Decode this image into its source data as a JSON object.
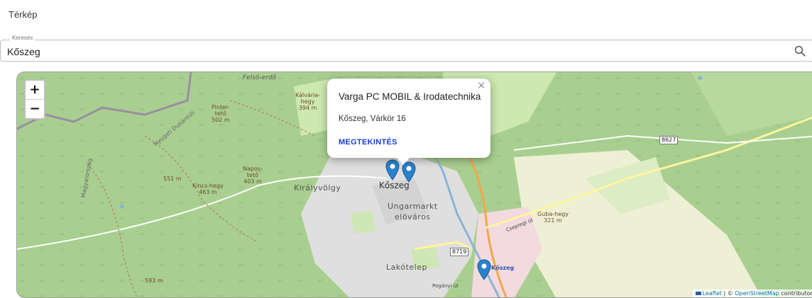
{
  "page": {
    "title": "Térkép"
  },
  "search": {
    "legend": "Keresés",
    "value": "Kőszeg",
    "icon": "search-icon"
  },
  "map": {
    "zoom_in": "+",
    "zoom_out": "−",
    "popup": {
      "title": "Varga PC MOBIL & Irodatechnika",
      "address": "Kőszeg, Várkör 16",
      "action": "MEGTEKINTÉS",
      "close": "×"
    },
    "labels": {
      "felso_erdo": "Felső-erdő",
      "kalvaria": "Kálvária-\nhegy\n394 m",
      "pinter": "Pinter-\ntető\n502 m",
      "nyugati": "Nyugati Dunántúli",
      "magyarorszag": "Magyarország",
      "m551": "551 m",
      "napos": "Napos-\ntető\n403 m",
      "kincs": "Kincs-hegy\n463 m",
      "kiralyvolgy": "Királyvölgy",
      "koszeg": "Kőszeg",
      "ungarmarkt": "Ungarmarkt",
      "elovaros": "elöváros",
      "cs_ut": "Csepregi út",
      "guba": "Guba-hegy\n321 m",
      "lakotelep": "Lakótelep",
      "koszeg_station": "Kőszeg",
      "m593": "593 m",
      "poganyi": "Pogányi út",
      "r8627": "8627",
      "r8719": "8719"
    },
    "attribution": {
      "leaflet": "Leaflet",
      "sep": " | © ",
      "osm": "OpenStreetMap",
      "rest": " contributors"
    },
    "colors": {
      "forest": "#a9cf90",
      "meadow": "#cde8b0",
      "urban": "#e0dfdf",
      "farmland": "#eef0d5",
      "marker": "#2a81cb",
      "link": "#1a3bd6"
    }
  }
}
